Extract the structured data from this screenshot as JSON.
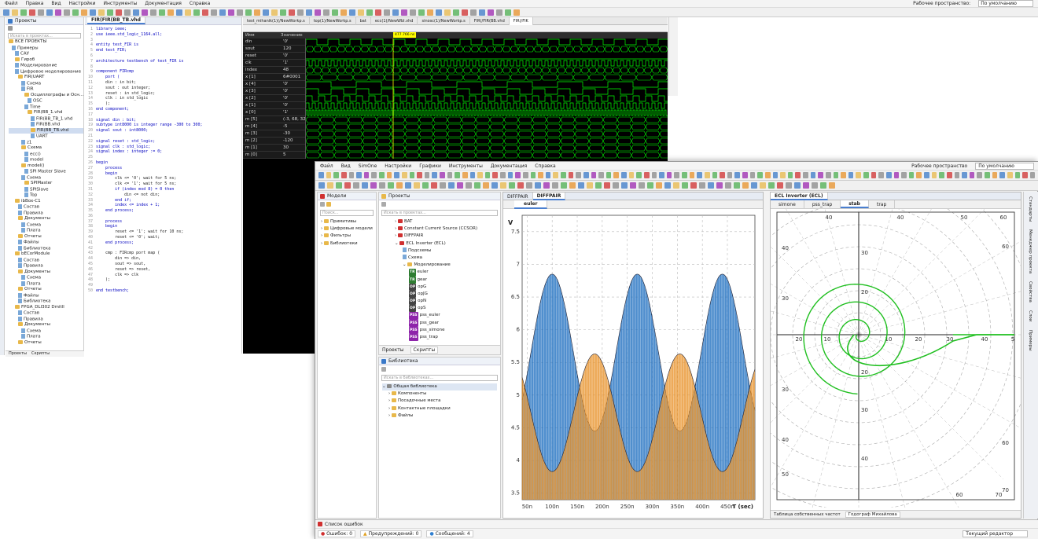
{
  "back_window": {
    "menu": [
      "Файл",
      "Правка",
      "Вид",
      "Настройки",
      "Инструменты",
      "Документация",
      "Справка"
    ],
    "workspace_label": "Рабочее пространство:",
    "workspace_value": "По умолчанию",
    "projects_panel": {
      "title": "Проекты",
      "search_placeholder": "Искать в проектах...",
      "tree": [
        "ВСЕ ПРОЕКТЫ",
        "Примеры",
        "САУ",
        "Гироб",
        "Моделирование",
        "Цифровое моделирование",
        "FIR(UART",
        "Схема",
        "FIR",
        "Осциллографы и Осн...",
        "OSC",
        "Time",
        "FIR(BB_1.vhd",
        "FIR(BB_TB_1.vhd",
        "FIR(BB.vhd",
        "FIR(BB_TB.vhd",
        "UART",
        "z1",
        "Схема",
        "ecc()",
        "model",
        "model()",
        "SPI Master Slave",
        "Схема",
        "SPIMaster",
        "SPISlave",
        "Top",
        "ibBox-C1",
        "Состав",
        "Правила",
        "Документы",
        "Схема",
        "Плата",
        "Отчеты",
        "Файлы",
        "Библиотека",
        "bECorModule",
        "Состав",
        "Правила",
        "Документы",
        "Схема",
        "Плата",
        "Отчеты",
        "Файлы",
        "Библиотека",
        "FPGA_DLI302 Dmitll",
        "Состав",
        "Правила",
        "Документы",
        "Схема",
        "Плата",
        "Отчеты",
        "Файлы",
        "Библиотека",
        "Конструктор управления ЦД Ф.1...",
        "Плата управления",
        "Состав",
        "Правила",
        "Документы"
      ],
      "bottom_tabs": [
        "Проекты",
        "Скрипты"
      ]
    },
    "editor": {
      "tab": "FIR(FIR(BB_TB.vhd",
      "lines": [
        "library ieee;",
        "use ieee.std_logic_1164.all;",
        "",
        "entity test_FIR is",
        "end test_FIR;",
        "",
        "architecture testbench of test_FIR is",
        "",
        "component FIRcmp",
        "    port (",
        "    din : in bit;",
        "    sout : out integer;",
        "    reset : in std_logic;",
        "    clk : in std_logic",
        "    );",
        "end component;",
        "",
        "signal din : bit;",
        "subtype int8000 is integer range -300 to 300;",
        "signal sout : int8000;",
        "",
        "signal reset : std_logic;",
        "signal clk : std_logic;",
        "signal index : integer := 0;",
        "",
        "begin",
        "    process",
        "    begin",
        "        clk <= '0'; wait for 5 ns;",
        "        clk <= '1'; wait for 5 ns;",
        "        if (index mod 8) = 0 then",
        "            din <= not din;",
        "        end if;",
        "        index <= index + 1;",
        "    end process;",
        "",
        "    process",
        "    begin",
        "        reset <= '1'; wait for 10 ns;",
        "        reset <= '0'; wait;",
        "    end process;",
        "",
        "    cmp : FIRcmp port map (",
        "        din => din,",
        "        sout => sout,",
        "        reset => reset,",
        "        clk => clk",
        "    );",
        "",
        "end testbench;"
      ]
    },
    "wave_tabs": [
      "test_mihanik(1)(/NewWorkp.s",
      "top(1)/NewWorkp.s",
      "bat",
      "ecc(1)/NewWbl.vhd",
      "sinosc(1)/NewWorkp.s",
      "FIR(/FIR(BB.vhd",
      "FIR(/FIK"
    ],
    "wave_header": [
      "Имя",
      "Значение"
    ],
    "wave_marker": "477.766 ns",
    "signals": [
      [
        "din",
        "'0'"
      ],
      [
        "sout",
        "120"
      ],
      [
        "reset",
        "'0'"
      ],
      [
        "clk",
        "'1'"
      ],
      [
        "index",
        "48"
      ],
      [
        "x [1]",
        "6#0001"
      ],
      [
        "x [4]",
        "'0'"
      ],
      [
        "x [3]",
        "'0'"
      ],
      [
        "x [2]",
        "'0'"
      ],
      [
        "x [1]",
        "'0'"
      ],
      [
        "x [0]",
        "'1'"
      ],
      [
        "m [5]",
        "(-3, 68, 32..."
      ],
      [
        "m [4]",
        "-5"
      ],
      [
        "m [3]",
        "-30"
      ],
      [
        "m [2]",
        "-120"
      ],
      [
        "m [1]",
        "30"
      ],
      [
        "m [0]",
        "5"
      ]
    ]
  },
  "front_window": {
    "menu": [
      "Файл",
      "Вид",
      "SimOne",
      "Настройки",
      "Графики",
      "Инструменты",
      "Документация",
      "Справка"
    ],
    "workspace_label": "Рабочее пространство",
    "workspace_value": "По умолчанию",
    "models_panel": {
      "title": "Модели",
      "search_placeholder": "Поиск...",
      "items": [
        "Примитивы",
        "Цифровые модели",
        "Фильтры",
        "Библиотеки"
      ]
    },
    "projects_panel": {
      "title": "Проекты",
      "search_placeholder": "Искать в проектах...",
      "tree": [
        [
          "folder",
          "BAT"
        ],
        [
          "folder",
          "Constant Current Source (CCSOR)"
        ],
        [
          "folder",
          "DIFFPAIR"
        ],
        [
          "folder",
          "ECL Inverter (ECL)"
        ],
        [
          "doc",
          "Подсхемы"
        ],
        [
          "doc",
          "Схема"
        ],
        [
          "folder",
          "Моделирование"
        ],
        [
          "TR",
          "euler"
        ],
        [
          "TR",
          "gear"
        ],
        [
          "OP",
          "opG"
        ],
        [
          "OP",
          "opJG"
        ],
        [
          "OP",
          "opN"
        ],
        [
          "OP",
          "opS"
        ],
        [
          "PSS",
          "pss_euler"
        ],
        [
          "PSS",
          "pss_gear"
        ],
        [
          "PSS",
          "pss_simone"
        ],
        [
          "PSS",
          "pss_trap"
        ]
      ],
      "bottom_tabs": [
        "Проекты",
        "Скрипты"
      ]
    },
    "library_panel": {
      "title": "Библиотека",
      "search_placeholder": "Искать в библиотеках...",
      "root": "Общая библиотека",
      "items": [
        "Компоненты",
        "Посадочные места",
        "Контактные площадки",
        "Файлы"
      ]
    },
    "plot_tabs": [
      "DIFFPAIR",
      "DIFFPAIR"
    ],
    "plot_subtab": "euler",
    "polar_tab": "ECL Inverter (ECL)",
    "polar_subtabs": [
      "simone",
      "pss_trap",
      "stab",
      "trap"
    ],
    "polar_bottom_tabs": [
      "Таблица собственных частот",
      "Годограф Михайлова"
    ],
    "errors_panel": {
      "title": "Список ошибок",
      "errors": "Ошибок: 0",
      "warnings": "Предупреждений: 0",
      "messages": "Сообщений: 4",
      "editor_select": "Текущий редактор"
    },
    "right_sidebar": [
      "Стандарты",
      "Менеджер проекта",
      "Свойства",
      "Слои",
      "Примеры"
    ]
  },
  "chart_data": {
    "type": "line",
    "ylabel": "V",
    "xlabel": "T (sec)",
    "xlim": [
      40,
      505
    ],
    "ylim": [
      3.4,
      7.75
    ],
    "yticks": [
      3.5,
      4,
      4.5,
      5,
      5.5,
      6,
      6.5,
      7,
      7.5
    ],
    "xticks": [
      "50n",
      "100n",
      "150n",
      "200n",
      "250n",
      "300n",
      "350n",
      "400n",
      "450n"
    ],
    "series": [
      {
        "color": "#1f6fc0",
        "amplitude": 1.2,
        "center": 5.65,
        "period": 170,
        "phase": 100
      },
      {
        "color": "#e8922a",
        "amplitude": 0.9,
        "center": 4.73,
        "period": 170,
        "phase": 185
      }
    ]
  },
  "polar_data": {
    "top_ticks": [
      "40",
      "40",
      "50",
      "60"
    ],
    "bottom_ticks": [
      "60",
      "70"
    ],
    "left_ticks": [
      "40",
      "30",
      "30",
      "40",
      "50"
    ],
    "right_ticks": [
      "60",
      "60",
      "70"
    ],
    "axis_ticks": [
      "20",
      "10",
      "10",
      "20",
      "30",
      "40",
      "5"
    ],
    "inner_ticks": [
      "30",
      "20",
      "20",
      "30",
      "40"
    ],
    "curve_color": "#1fbf1f"
  }
}
